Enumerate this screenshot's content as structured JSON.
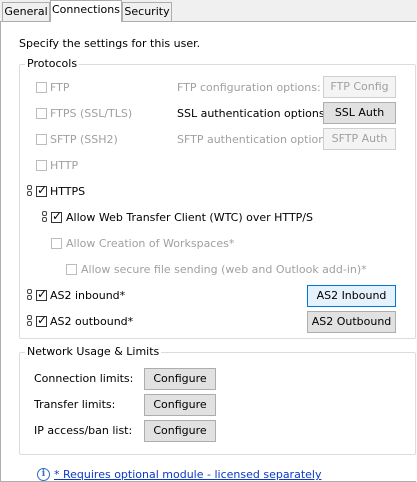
{
  "tabs": [
    {
      "label": "General"
    },
    {
      "label": "Connections"
    },
    {
      "label": "Security"
    }
  ],
  "intro": "Specify the settings for this user.",
  "protocols": {
    "title": "Protocols",
    "ftp": {
      "label": "FTP",
      "option_label": "FTP configuration options:",
      "button": "FTP Config"
    },
    "ftps": {
      "label": "FTPS (SSL/TLS)",
      "option_label": "SSL authentication options:",
      "button": "SSL Auth"
    },
    "sftp": {
      "label": "SFTP (SSH2)",
      "option_label": "SFTP authentication options:",
      "button": "SFTP Auth"
    },
    "http": {
      "label": "HTTP"
    },
    "https": {
      "label": "HTTPS"
    },
    "wtc": {
      "label": "Allow Web Transfer Client  (WTC) over HTTP/S"
    },
    "workspaces": {
      "label": "Allow Creation of Workspaces*"
    },
    "secure_send": {
      "label": "Allow secure file sending (web and Outlook add-in)*"
    },
    "as2_inbound": {
      "label": "AS2 inbound*",
      "button": "AS2 Inbound"
    },
    "as2_outbound": {
      "label": "AS2 outbound*",
      "button": "AS2 Outbound"
    }
  },
  "network": {
    "title": "Network Usage & Limits",
    "rows": [
      {
        "label": "Connection limits:",
        "button": "Configure"
      },
      {
        "label": "Transfer limits:",
        "button": "Configure"
      },
      {
        "label": "IP access/ban list:",
        "button": "Configure"
      }
    ]
  },
  "footnote": "* Requires optional module - licensed separately"
}
